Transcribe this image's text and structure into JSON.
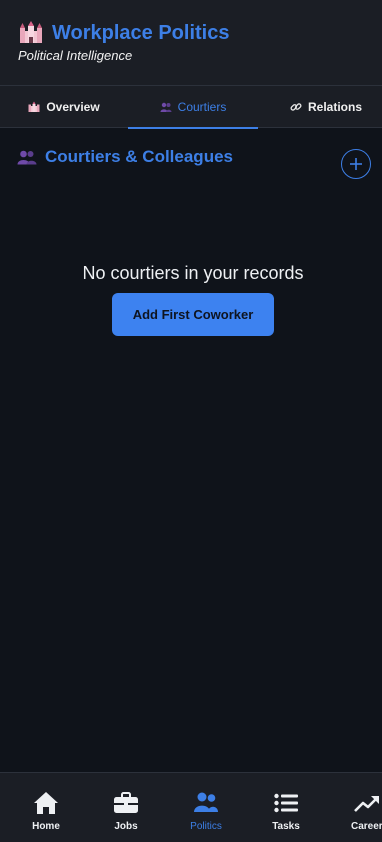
{
  "header": {
    "title": "Workplace Politics",
    "subtitle": "Political Intelligence",
    "icon": "castle-icon"
  },
  "tabs": [
    {
      "label": "Overview",
      "icon": "castle-icon",
      "active": false
    },
    {
      "label": "Courtiers",
      "icon": "people-icon",
      "active": true
    },
    {
      "label": "Relations",
      "icon": "link-icon",
      "active": false
    }
  ],
  "section": {
    "title": "Courtiers & Colleagues",
    "icon": "people-icon",
    "add_icon": "plus-icon"
  },
  "empty_state": {
    "message": "No courtiers in your records",
    "button_label": "Add First Coworker"
  },
  "bottom_nav": [
    {
      "label": "Home",
      "icon": "home-icon",
      "active": false
    },
    {
      "label": "Jobs",
      "icon": "briefcase-icon",
      "active": false
    },
    {
      "label": "Politics",
      "icon": "people-icon",
      "active": true
    },
    {
      "label": "Tasks",
      "icon": "list-icon",
      "active": false
    },
    {
      "label": "Career",
      "icon": "trend-up-icon",
      "active": false
    }
  ],
  "colors": {
    "accent": "#3d7fe6",
    "background": "#0f131a",
    "surface": "#1b1e25"
  }
}
